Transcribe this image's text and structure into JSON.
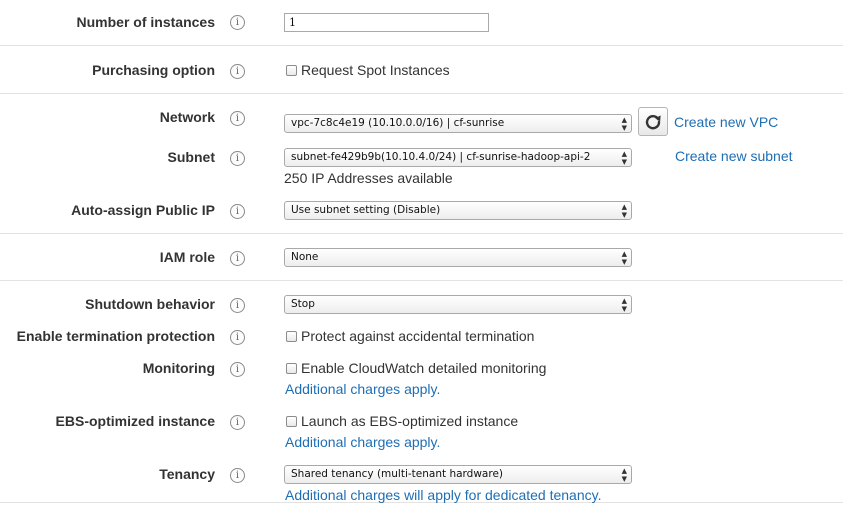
{
  "instances": {
    "label": "Number of instances",
    "value": "1"
  },
  "purchasing": {
    "label": "Purchasing option",
    "checkbox_label": "Request Spot Instances"
  },
  "network": {
    "label": "Network",
    "value": "vpc-7c8c4e19 (10.10.0.0/16) | cf-sunrise",
    "create_link": "Create new VPC"
  },
  "subnet": {
    "label": "Subnet",
    "value": "subnet-fe429b9b(10.10.4.0/24) | cf-sunrise-hadoop-api-2",
    "create_link": "Create new subnet",
    "available": "250 IP Addresses available"
  },
  "public_ip": {
    "label": "Auto-assign Public IP",
    "value": "Use subnet setting (Disable)"
  },
  "iam": {
    "label": "IAM role",
    "value": "None"
  },
  "shutdown": {
    "label": "Shutdown behavior",
    "value": "Stop"
  },
  "termination": {
    "label": "Enable termination protection",
    "checkbox_label": "Protect against accidental termination"
  },
  "monitoring": {
    "label": "Monitoring",
    "checkbox_label": "Enable CloudWatch detailed monitoring",
    "charges_link": "Additional charges apply."
  },
  "ebs": {
    "label": "EBS-optimized instance",
    "checkbox_label": "Launch as EBS-optimized instance",
    "charges_link": "Additional charges apply."
  },
  "tenancy": {
    "label": "Tenancy",
    "value": "Shared tenancy (multi-tenant hardware)",
    "charges_link": "Additional charges will apply for dedicated tenancy."
  },
  "icons": {
    "info": "i",
    "select_up": "▲",
    "select_down": "▼"
  },
  "colors": {
    "link": "#1e6eb4",
    "divider": "#e3e3e3"
  }
}
